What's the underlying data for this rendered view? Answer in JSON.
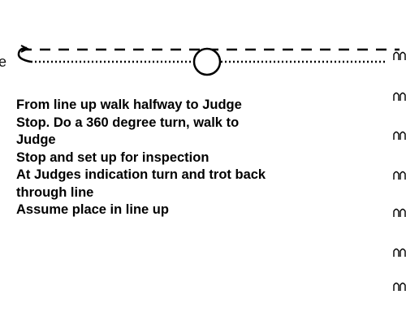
{
  "diagram": {
    "partial_label_left": "e",
    "line_color": "#000000",
    "figure_marks": [
      "horse-footprint-icon",
      "horse-footprint-icon",
      "horse-footprint-icon",
      "horse-footprint-icon",
      "horse-footprint-icon",
      "horse-footprint-icon",
      "horse-footprint-icon"
    ]
  },
  "instructions": [
    "From line up walk halfway to Judge",
    "Stop. Do a 360 degree turn, walk to\nJudge",
    "Stop and set up for inspection",
    "At Judges indication turn and trot back\nthrough line",
    "Assume place in line up"
  ]
}
